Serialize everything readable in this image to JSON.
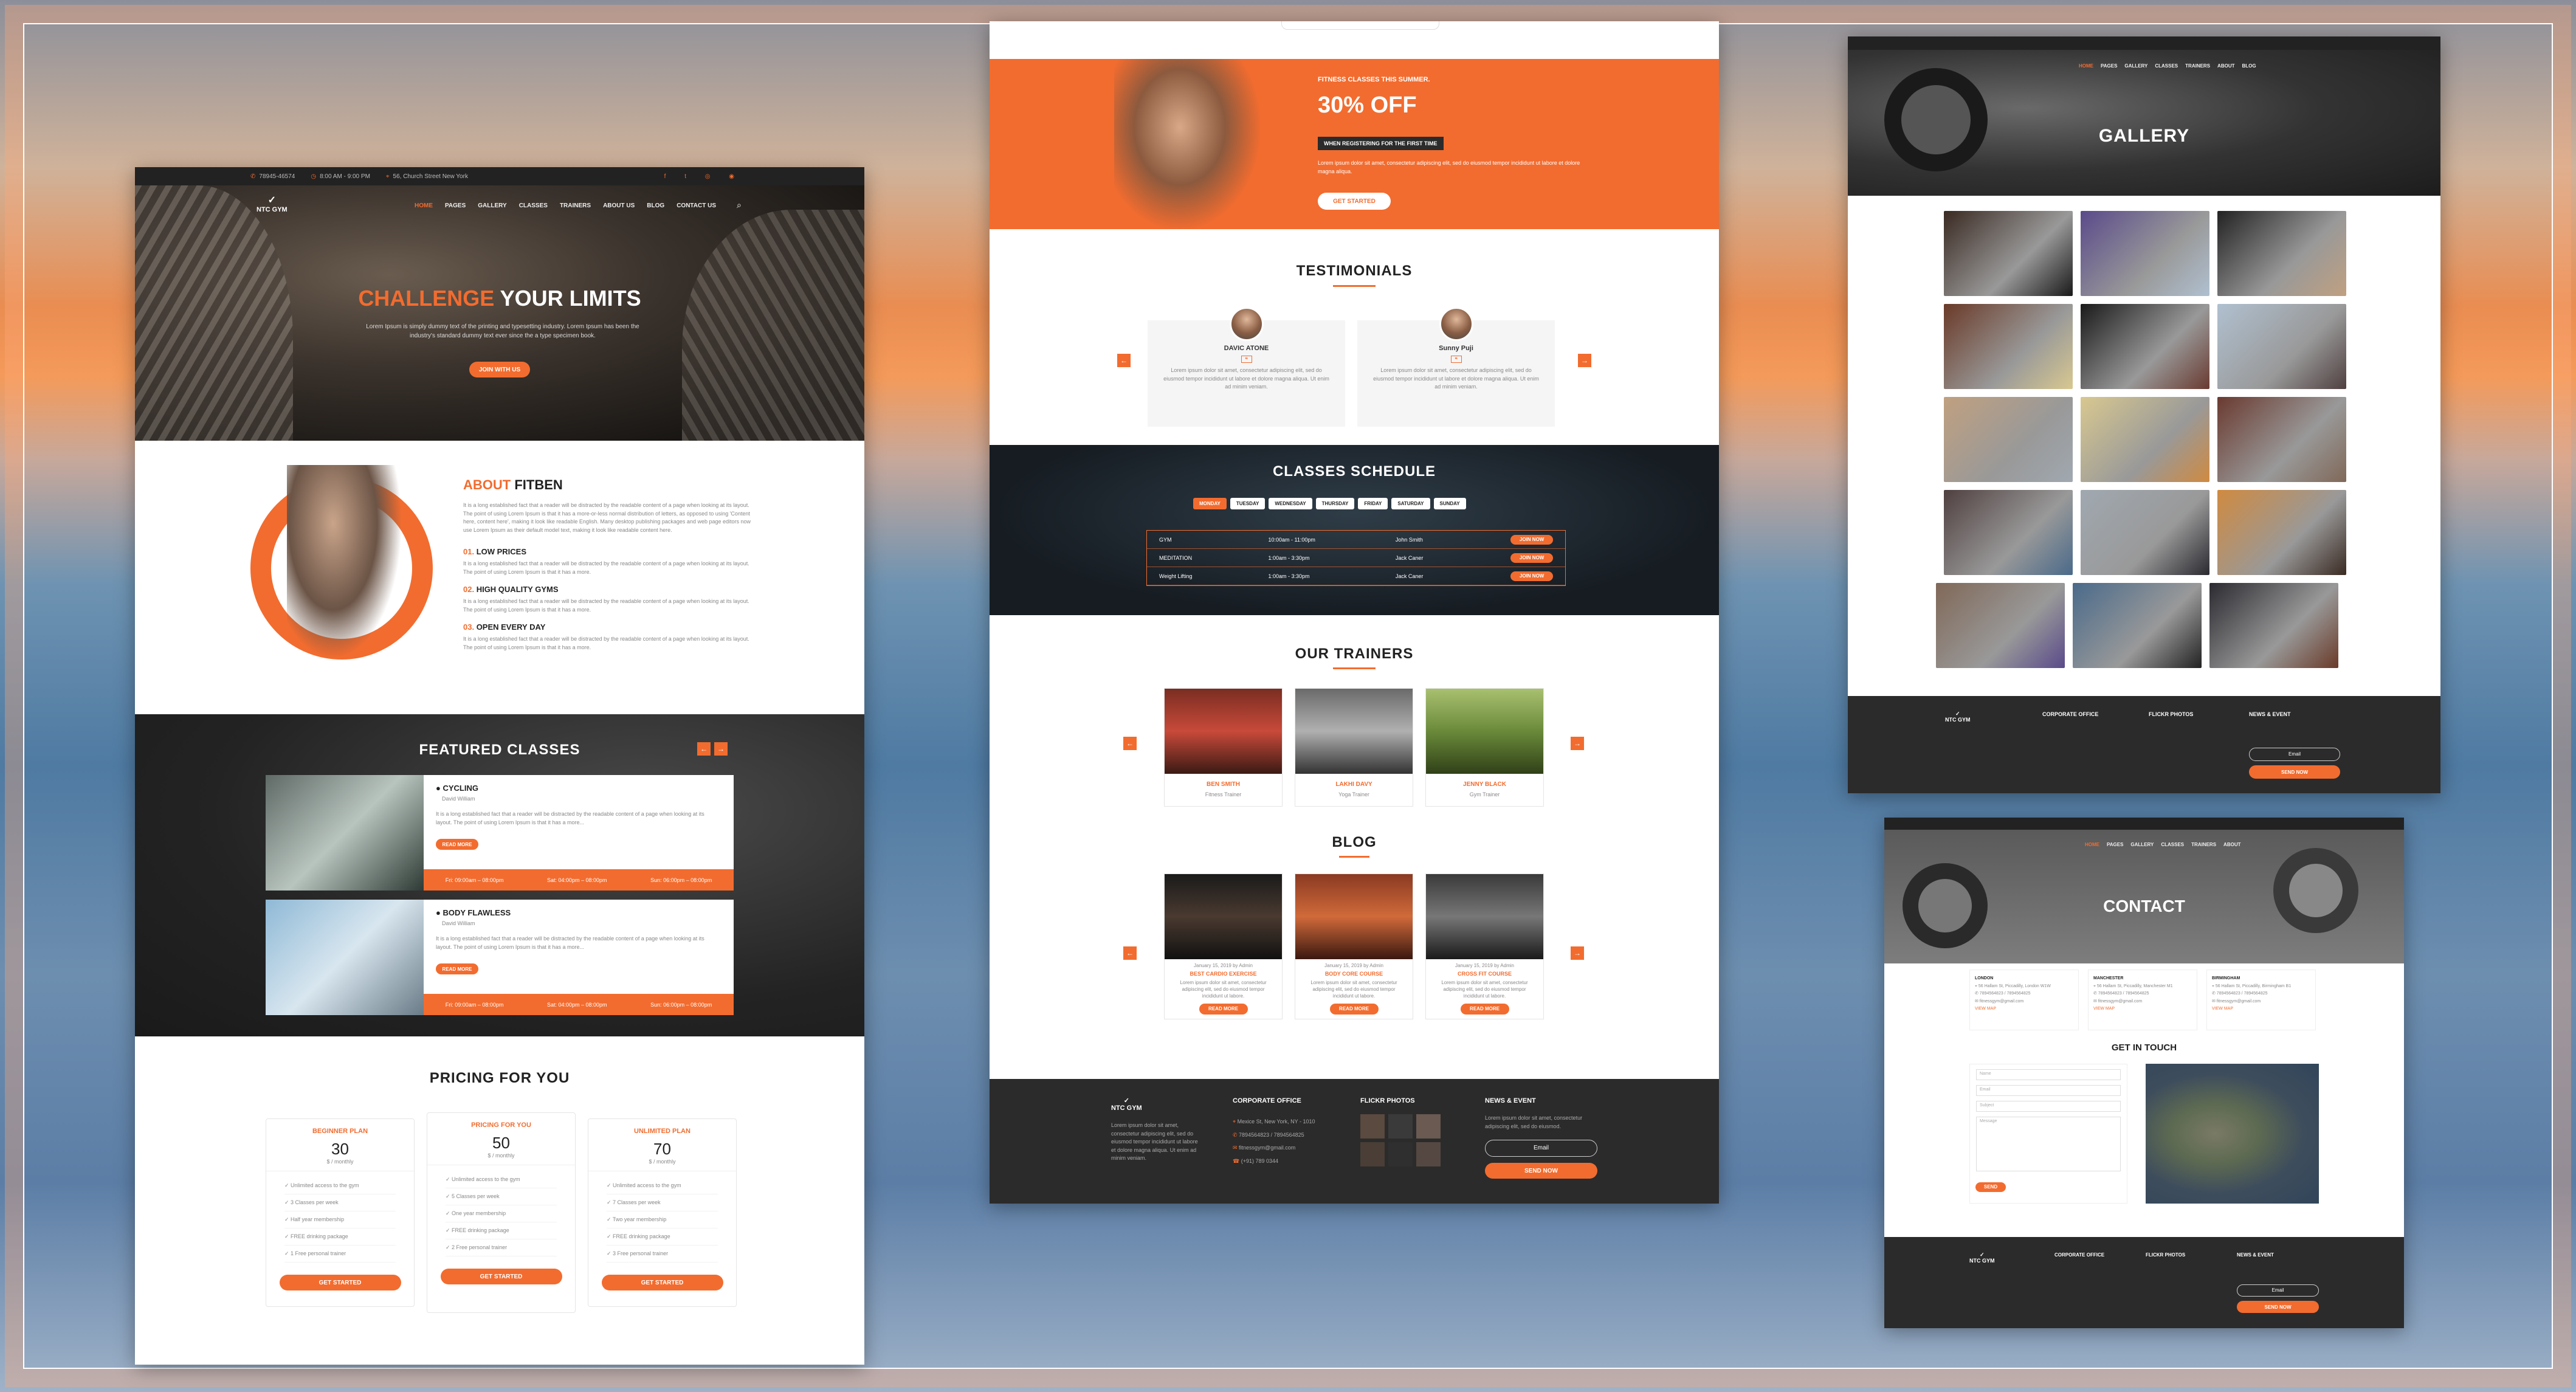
{
  "home": {
    "topbar": {
      "phone": "78945-46574",
      "hours": "8:00 AM - 9:00 PM",
      "address": "56, Church Street New York"
    },
    "logo": "NTC GYM",
    "nav": [
      "HOME",
      "PAGES",
      "GALLERY",
      "CLASSES",
      "TRAINERS",
      "ABOUT US",
      "BLOG",
      "CONTACT US"
    ],
    "hero": {
      "title_accent": "CHALLENGE",
      "title_rest": " YOUR LIMITS",
      "text": "Lorem Ipsum is simply dummy text of the printing and typesetting industry. Lorem Ipsum has been the industry's standard dummy text ever since the a type specimen book.",
      "button": "JOIN WITH US"
    },
    "about": {
      "title_accent": "ABOUT",
      "title_rest": " FITBEN",
      "text": "It is a long established fact that a reader will be distracted by the readable content of a page when looking at its layout. The point of using Lorem Ipsum is that it has a more-or-less normal distribution of letters, as opposed to using 'Content here, content here', making it look like readable English. Many desktop publishing packages and web page editors now use Lorem Ipsum as their default model text, making it look like readable content here.",
      "items": [
        {
          "num": "01.",
          "title": "LOW PRICES",
          "text": "It is a long established fact that a reader will be distracted by the readable content of a page when looking at its layout. The point of using Lorem Ipsum is that it has a more."
        },
        {
          "num": "02.",
          "title": "HIGH QUALITY GYMS",
          "text": "It is a long established fact that a reader will be distracted by the readable content of a page when looking at its layout. The point of using Lorem Ipsum is that it has a more."
        },
        {
          "num": "03.",
          "title": "OPEN EVERY DAY",
          "text": "It is a long established fact that a reader will be distracted by the readable content of a page when looking at its layout. The point of using Lorem Ipsum is that it has a more."
        }
      ]
    },
    "featured": {
      "title": "FEATURED CLASSES",
      "classes": [
        {
          "name": "CYCLING",
          "trainer": "David William",
          "text": "It is a long established fact that a reader will be distracted by the readable content of a page when looking at its layout. The point of using Lorem Ipsum is that it has a more...",
          "button": "READ MORE",
          "times": [
            "Fri: 09:00am – 08:00pm",
            "Sat: 04:00pm – 08:00pm",
            "Sun: 06:00pm – 08:00pm"
          ]
        },
        {
          "name": "BODY FLAWLESS",
          "trainer": "David William",
          "text": "It is a long established fact that a reader will be distracted by the readable content of a page when looking at its layout. The point of using Lorem Ipsum is that it has a more...",
          "button": "READ MORE",
          "times": [
            "Fri: 09:00am – 08:00pm",
            "Sat: 04:00pm – 08:00pm",
            "Sun: 06:00pm – 08:00pm"
          ]
        }
      ]
    },
    "pricing": {
      "title": "PRICING FOR YOU",
      "plans": [
        {
          "name": "BEGINNER PLAN",
          "price": "30",
          "period": "$ / monthly",
          "features": [
            "Unlimited access to the gym",
            "3 Classes per week",
            "Half year membership",
            "FREE drinking package",
            "1 Free personal trainer"
          ],
          "button": "GET STARTED"
        },
        {
          "name": "PRICING FOR YOU",
          "price": "50",
          "period": "$ / monthly",
          "features": [
            "Unlimited access to the gym",
            "5 Classes per week",
            "One year membership",
            "FREE drinking package",
            "2 Free personal trainer"
          ],
          "button": "GET STARTED"
        },
        {
          "name": "UNLIMITED PLAN",
          "price": "70",
          "period": "$ / monthly",
          "features": [
            "Unlimited access to the gym",
            "7 Classes per week",
            "Two year membership",
            "FREE drinking package",
            "3 Free personal trainer"
          ],
          "button": "GET STARTED"
        }
      ]
    }
  },
  "middle": {
    "promo": {
      "kicker": "FITNESS CLASSES THIS SUMMER.",
      "headline": "30% OFF",
      "badge": "WHEN REGISTERING FOR THE FIRST TIME",
      "text": "Lorem ipsum dolor sit amet, consectetur adipiscing elit, sed do eiusmod tempor incididunt ut labore et dolore magna aliqua.",
      "button": "GET STARTED"
    },
    "testimonials": {
      "title": "TESTIMONIALS",
      "items": [
        {
          "name": "DAVIC ATONE",
          "text": "Lorem ipsum dolor sit amet, consectetur adipiscing elit, sed do eiusmod tempor incididunt ut labore et dolore magna aliqua. Ut enim ad minim veniam."
        },
        {
          "name": "Sunny Puji",
          "text": "Lorem ipsum dolor sit amet, consectetur adipiscing elit, sed do eiusmod tempor incididunt ut labore et dolore magna aliqua. Ut enim ad minim veniam."
        }
      ]
    },
    "schedule": {
      "title": "CLASSES SCHEDULE",
      "days": [
        "MONDAY",
        "TUESDAY",
        "WEDNESDAY",
        "THURSDAY",
        "FRIDAY",
        "SATURDAY",
        "SUNDAY"
      ],
      "rows": [
        {
          "cls": "GYM",
          "time": "10:00am - 11:00pm",
          "trainer": "John Smith",
          "button": "JOIN NOW"
        },
        {
          "cls": "MEDITATION",
          "time": "1:00am - 3:30pm",
          "trainer": "Jack Caner",
          "button": "JOIN NOW"
        },
        {
          "cls": "Weight Lifting",
          "time": "1:00am - 3:30pm",
          "trainer": "Jack Caner",
          "button": "JOIN NOW"
        }
      ]
    },
    "trainers": {
      "title": "OUR TRAINERS",
      "items": [
        {
          "name": "BEN SMITH",
          "role": "Fitness Trainer"
        },
        {
          "name": "LAKHI DAVY",
          "role": "Yoga Trainer"
        },
        {
          "name": "JENNY BLACK",
          "role": "Gym Trainer"
        }
      ]
    },
    "blog": {
      "title": "BLOG",
      "posts": [
        {
          "meta": "January 15, 2019 by Admin",
          "title": "BEST CARDIO EXERCISE",
          "text": "Lorem ipsum dolor sit amet, consectetur adipiscing elit, sed do eiusmod tempor incididunt ut labore.",
          "button": "READ MORE"
        },
        {
          "meta": "January 15, 2019 by Admin",
          "title": "BODY CORE COURSE",
          "text": "Lorem ipsum dolor sit amet, consectetur adipiscing elit, sed do eiusmod tempor incididunt ut labore.",
          "button": "READ MORE"
        },
        {
          "meta": "January 15, 2019 by Admin",
          "title": "CROSS FIT COURSE",
          "text": "Lorem ipsum dolor sit amet, consectetur adipiscing elit, sed do eiusmod tempor incididunt ut labore.",
          "button": "READ MORE"
        }
      ]
    },
    "footer": {
      "logo": "NTC GYM",
      "about": "Lorem ipsum dolor sit amet, consectetur adipiscing elit, sed do eiusmod tempor incididunt ut labore et dolore magna aliqua. Ut enim ad minim veniam.",
      "office_title": "CORPORATE OFFICE",
      "address": "Mexice St, New York, NY - 1010",
      "phone": "7894564823 / 7894564825",
      "email": "fitnessgym@gmail.com",
      "fax": "(+91) 789 0344",
      "photos_title": "FLICKR PHOTOS",
      "news_title": "NEWS & EVENT",
      "news_text": "Lorem ipsum dolor sit amet, consectetur adipiscing elit, sed do eiusmod.",
      "email_placeholder": "Email",
      "button": "SEND NOW"
    }
  },
  "gallery": {
    "title": "GALLERY"
  },
  "contact": {
    "title": "CONTACT",
    "offices": [
      {
        "city": "LONDON",
        "addr": "56 Hallam St, Piccadilly, London W1W",
        "phone": "7894564823 / 7894564825",
        "email": "fitnessgym@gmail.com",
        "button": "VIEW MAP"
      },
      {
        "city": "MANCHESTER",
        "addr": "56 Hallam St, Piccadilly, Manchester M1",
        "phone": "7894564823 / 7894564825",
        "email": "fitnessgym@gmail.com",
        "button": "VIEW MAP"
      },
      {
        "city": "BIRMINGHAM",
        "addr": "56 Hallam St, Piccadilly, Birmingham B1",
        "phone": "7894564823 / 7894564825",
        "email": "fitnessgym@gmail.com",
        "button": "VIEW MAP"
      }
    ],
    "form_title": "GET IN TOUCH",
    "fields": [
      "Name",
      "Email",
      "Subject",
      "Message"
    ],
    "send": "SEND"
  }
}
